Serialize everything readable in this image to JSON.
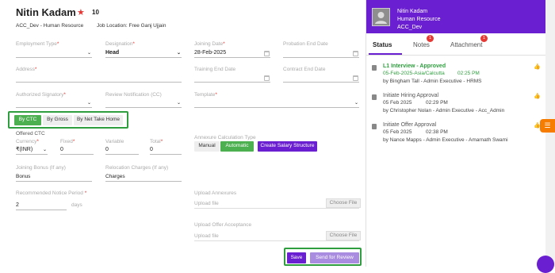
{
  "candidate": {
    "name": "Nitin Kadam",
    "score": "10",
    "company": "ACC_Dev - Human Resource",
    "job_location": "Job Location: Free Ganj Ujjain"
  },
  "form": {
    "employment_type": {
      "label": "Employment Type",
      "value": ""
    },
    "designation": {
      "label": "Designation",
      "value": "Head"
    },
    "joining_date": {
      "label": "Joining Date",
      "value": "28-Feb-2025"
    },
    "probation_end_date": {
      "label": "Probation End Date",
      "value": ""
    },
    "address": {
      "label": "Address",
      "value": ""
    },
    "training_end_date": {
      "label": "Training End Date",
      "value": ""
    },
    "contract_end_date": {
      "label": "Contract End Date",
      "value": ""
    },
    "authorized_signatory": {
      "label": "Authorized Signatory",
      "value": ""
    },
    "review_notification": {
      "label": "Review Notification (CC)",
      "value": ""
    },
    "template": {
      "label": "Template",
      "value": ""
    },
    "ctc_tabs": [
      "By CTC",
      "By Gross",
      "By Net Take Home"
    ],
    "offered_ctc_label": "Offered CTC",
    "currency": {
      "label": "Currency",
      "value": "₹(INR)"
    },
    "fixed": {
      "label": "Fixed",
      "value": "0"
    },
    "variable": {
      "label": "Variable",
      "value": "0"
    },
    "total": {
      "label": "Total",
      "value": "0"
    },
    "annexure": {
      "label": "Annexure Calculation Type",
      "manual": "Manual",
      "automatic": "Automatic",
      "create": "Create Salary Structure"
    },
    "joining_bonus": {
      "label": "Joining Bonus (If any)",
      "value": "Bonus"
    },
    "relocation": {
      "label": "Relocation Charges (If any)",
      "value": "Charges"
    },
    "notice_period": {
      "label": "Recommended Notice Period",
      "value": "2",
      "unit": "days"
    },
    "upload_annexures": {
      "label": "Upload Annexures",
      "placeholder": "Upload file",
      "button": "Choose File"
    },
    "upload_offer": {
      "label": "Upload Offer Acceptance",
      "placeholder": "Upload file",
      "button": "Choose File"
    },
    "save": "Save",
    "send_review": "Send for Review"
  },
  "profile": {
    "name": "Nitin Kadam",
    "department": "Human Resource",
    "org": "ACC_Dev"
  },
  "tabs": [
    {
      "label": "Status",
      "badge": ""
    },
    {
      "label": "Notes",
      "badge": "1"
    },
    {
      "label": "Attachment",
      "badge": "1"
    }
  ],
  "status_items": [
    {
      "title": "L1 Interview - Approved",
      "date": "05-Feb-2025-Asia/Calcutta",
      "time": "02:25 PM",
      "by": "by Bingham Tall - Admin Executive - HRMS",
      "approved": true
    },
    {
      "title": "Initiate Hiring Approval",
      "date": "05 Feb 2025",
      "time": "02:29 PM",
      "by": "by Christopher Nolan - Admin Executive - Acc_Admin",
      "approved": false
    },
    {
      "title": "Initiate Offer Approval",
      "date": "05 Feb 2025",
      "time": "02:38 PM",
      "by": "by Nance Mapps - Admin Executive - Amarnath Swami",
      "approved": false
    }
  ],
  "colors": {
    "accent": "#6a1fd0",
    "green": "#4caf50",
    "orange": "#f57c00",
    "highlight": "#2e9e3e",
    "badge": "#e53935"
  }
}
